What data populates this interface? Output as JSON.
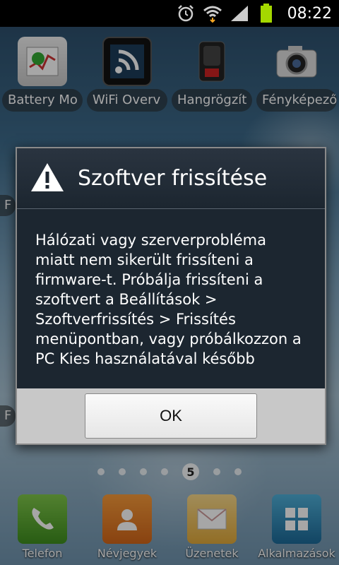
{
  "status_bar": {
    "time": "08:22",
    "icons": [
      "alarm-icon",
      "wifi-icon",
      "signal-icon",
      "battery-icon"
    ],
    "battery_color": "#a4d800"
  },
  "home": {
    "apps": [
      {
        "label": "Battery Mo",
        "icon": "battery-monitor-icon"
      },
      {
        "label": "WiFi Overv",
        "icon": "wifi-overview-icon"
      },
      {
        "label": "Hangrögzít",
        "icon": "voice-recorder-icon"
      },
      {
        "label": "Fényképező",
        "icon": "camera-icon"
      }
    ],
    "dock": [
      {
        "label": "Telefon",
        "icon": "phone-icon"
      },
      {
        "label": "Névjegyek",
        "icon": "contacts-icon"
      },
      {
        "label": "Üzenetek",
        "icon": "messages-icon"
      },
      {
        "label": "Alkalmazások",
        "icon": "apps-grid-icon"
      }
    ],
    "current_page": "5"
  },
  "dialog": {
    "icon": "warning-icon",
    "title": "Szoftver frissítése",
    "message": "Hálózati vagy szerverprobléma miatt nem sikerült frissíteni a firmware-t. Próbálja frissíteni a szoftvert a Beállítások > Szoftverfrissítés > Frissítés menüpontban, vagy próbálkozzon a PC Kies használatával később",
    "ok_label": "OK"
  }
}
